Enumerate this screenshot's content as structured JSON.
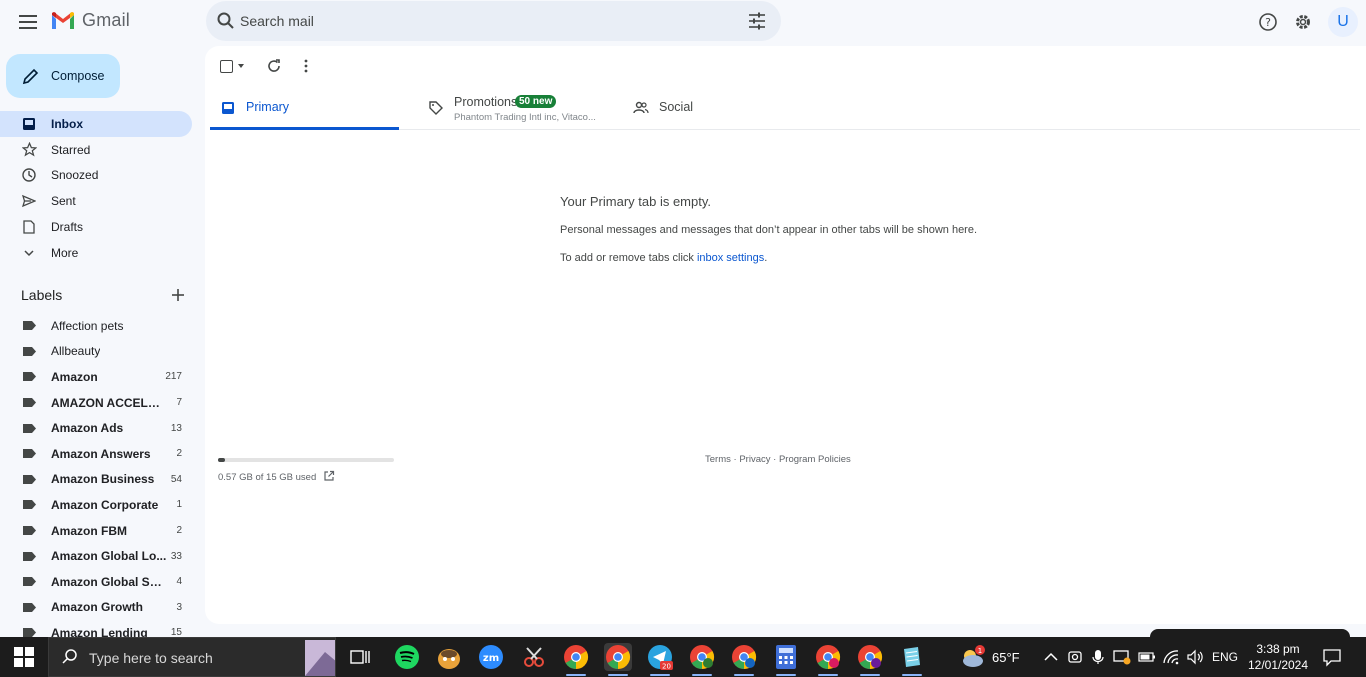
{
  "header": {
    "app_name": "Gmail",
    "search_placeholder": "Search mail",
    "avatar_letter": "U"
  },
  "sidebar": {
    "compose_label": "Compose",
    "items": [
      {
        "label": "Inbox",
        "icon": "inbox-icon",
        "active": true
      },
      {
        "label": "Starred",
        "icon": "star-icon"
      },
      {
        "label": "Snoozed",
        "icon": "clock-icon"
      },
      {
        "label": "Sent",
        "icon": "send-icon"
      },
      {
        "label": "Drafts",
        "icon": "draft-icon"
      },
      {
        "label": "More",
        "icon": "chevron-down-icon"
      }
    ],
    "labels_heading": "Labels",
    "labels": [
      {
        "name": "Affection pets",
        "count": "",
        "bold": false
      },
      {
        "name": "Allbeauty",
        "count": "",
        "bold": false
      },
      {
        "name": "Amazon",
        "count": "217",
        "bold": true
      },
      {
        "name": "AMAZON ACCELER...",
        "count": "7",
        "bold": true
      },
      {
        "name": "Amazon Ads",
        "count": "13",
        "bold": true
      },
      {
        "name": "Amazon Answers",
        "count": "2",
        "bold": true
      },
      {
        "name": "Amazon Business",
        "count": "54",
        "bold": true
      },
      {
        "name": "Amazon Corporate",
        "count": "1",
        "bold": true
      },
      {
        "name": "Amazon FBM",
        "count": "2",
        "bold": true
      },
      {
        "name": "Amazon Global Lo...",
        "count": "33",
        "bold": true
      },
      {
        "name": "Amazon Global Sell...",
        "count": "4",
        "bold": true
      },
      {
        "name": "Amazon Growth",
        "count": "3",
        "bold": true
      },
      {
        "name": "Amazon Lending",
        "count": "15",
        "bold": true
      }
    ]
  },
  "tabs": {
    "primary": "Primary",
    "promotions": "Promotions",
    "promotions_badge": "50 new",
    "promotions_sub": "Phantom Trading Intl inc, Vitaco...",
    "social": "Social"
  },
  "empty_state": {
    "title": "Your Primary tab is empty.",
    "description": "Personal messages and messages that don’t appear in other tabs will be shown here.",
    "settings_prefix": "To add or remove tabs click ",
    "settings_link": "inbox settings",
    "settings_suffix": "."
  },
  "storage": {
    "text": "0.57 GB of 15 GB used",
    "fraction": 0.038
  },
  "footer": {
    "terms": "Terms",
    "privacy": "Privacy",
    "policies": "Program Policies",
    "sep": " · "
  },
  "taskbar": {
    "search_placeholder": "Type here to search",
    "weather_temp": "65°F",
    "weather_badge": "1",
    "language": "ENG",
    "time": "3:38 pm",
    "date": "12/01/2024",
    "telegram_badge": "20"
  },
  "colors": {
    "accent": "#0b57d0",
    "compose_bg": "#c2e7ff",
    "active_nav": "#d3e3fd",
    "promo_badge": "#188038"
  }
}
